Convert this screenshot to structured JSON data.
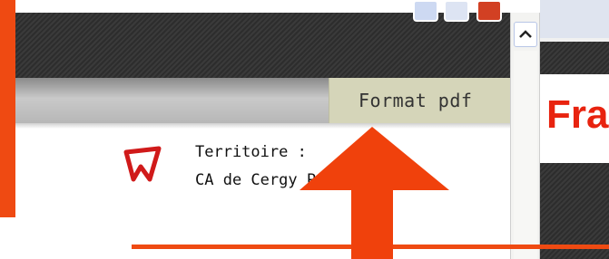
{
  "popup": {
    "format_pdf_label": "Format pdf",
    "territory_title": "Territoire :",
    "territory_name": "CA de Cergy Pontoise (95)"
  },
  "background_page": {
    "partial_heading": "Fra"
  },
  "colors": {
    "accent_orange": "#ef4a12",
    "pdf_tab": "#d5d5b9",
    "logo_red": "#d01a1a",
    "close_button": "#d24023"
  },
  "icons": {
    "logo": "red-chevron-logo-icon",
    "scroll_up": "chevron-up-icon",
    "window_close": "close-icon",
    "window_minimize": "minimize-icon",
    "window_maximize": "maximize-icon",
    "annotation": "arrow-up-icon"
  }
}
